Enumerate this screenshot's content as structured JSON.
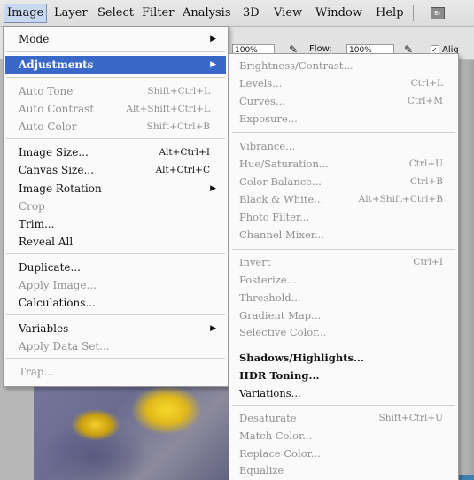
{
  "menubar": {
    "items": [
      "Image",
      "Layer",
      "Select",
      "Filter",
      "Analysis",
      "3D",
      "View",
      "Window",
      "Help"
    ],
    "icon_label": "Br"
  },
  "optbar": {
    "opacity_value": "100%",
    "flow_label": "Flow:",
    "flow_value": "100%",
    "aligned_label": "Alig"
  },
  "image_menu": {
    "mode": "Mode",
    "adjustments": "Adjustments",
    "auto_tone": "Auto Tone",
    "auto_tone_sc": "Shift+Ctrl+L",
    "auto_contrast": "Auto Contrast",
    "auto_contrast_sc": "Alt+Shift+Ctrl+L",
    "auto_color": "Auto Color",
    "auto_color_sc": "Shift+Ctrl+B",
    "image_size": "Image Size...",
    "image_size_sc": "Alt+Ctrl+I",
    "canvas_size": "Canvas Size...",
    "canvas_size_sc": "Alt+Ctrl+C",
    "image_rotation": "Image Rotation",
    "crop": "Crop",
    "trim": "Trim...",
    "reveal_all": "Reveal All",
    "duplicate": "Duplicate...",
    "apply_image": "Apply Image...",
    "calculations": "Calculations...",
    "variables": "Variables",
    "apply_data_set": "Apply Data Set...",
    "trap": "Trap..."
  },
  "adjustments_menu": {
    "brightness_contrast": "Brightness/Contrast...",
    "levels": "Levels...",
    "levels_sc": "Ctrl+L",
    "curves": "Curves...",
    "curves_sc": "Ctrl+M",
    "exposure": "Exposure...",
    "vibrance": "Vibrance...",
    "hue_saturation": "Hue/Saturation...",
    "hue_saturation_sc": "Ctrl+U",
    "color_balance": "Color Balance...",
    "color_balance_sc": "Ctrl+B",
    "black_white": "Black & White...",
    "black_white_sc": "Alt+Shift+Ctrl+B",
    "photo_filter": "Photo Filter...",
    "channel_mixer": "Channel Mixer...",
    "invert": "Invert",
    "invert_sc": "Ctrl+I",
    "posterize": "Posterize...",
    "threshold": "Threshold...",
    "gradient_map": "Gradient Map...",
    "selective_color": "Selective Color...",
    "shadows_highlights": "Shadows/Highlights...",
    "hdr_toning": "HDR Toning...",
    "variations": "Variations...",
    "desaturate": "Desaturate",
    "desaturate_sc": "Shift+Ctrl+U",
    "match_color": "Match Color...",
    "replace_color": "Replace Color...",
    "equalize": "Equalize"
  },
  "colors": {
    "highlight": "#3a68c8",
    "disabled_text": "#8f8f8f"
  }
}
